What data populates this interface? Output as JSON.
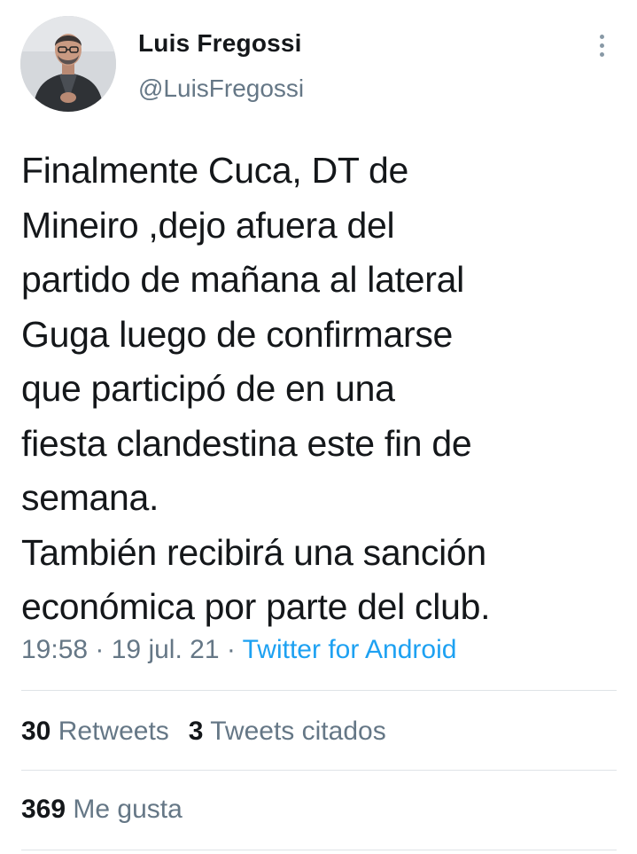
{
  "author": {
    "display_name": "Luis Fregossi",
    "handle": "@LuisFregossi"
  },
  "tweet": {
    "text_lines": [
      "Finalmente Cuca, DT de",
      "Mineiro ,dejo afuera del",
      "partido de mañana al lateral",
      "Guga luego de confirmarse",
      "que participó de en una",
      "fiesta clandestina este fin de",
      "semana.",
      "También recibirá una sanción",
      "económica por parte del club."
    ]
  },
  "meta": {
    "time": "19:58",
    "sep1": " · ",
    "date": "19 jul. 21",
    "sep2": " · ",
    "source": "Twitter for Android"
  },
  "stats": {
    "retweets_count": "30",
    "retweets_label": "Retweets",
    "quotes_count": "3",
    "quotes_label": "Tweets citados",
    "likes_count": "369",
    "likes_label": "Me gusta"
  },
  "icons": {
    "more": "more-vertical-icon"
  },
  "colors": {
    "text_primary": "#14171a",
    "text_secondary": "#657786",
    "link": "#1da1f2",
    "divider": "#dfe3e7"
  }
}
